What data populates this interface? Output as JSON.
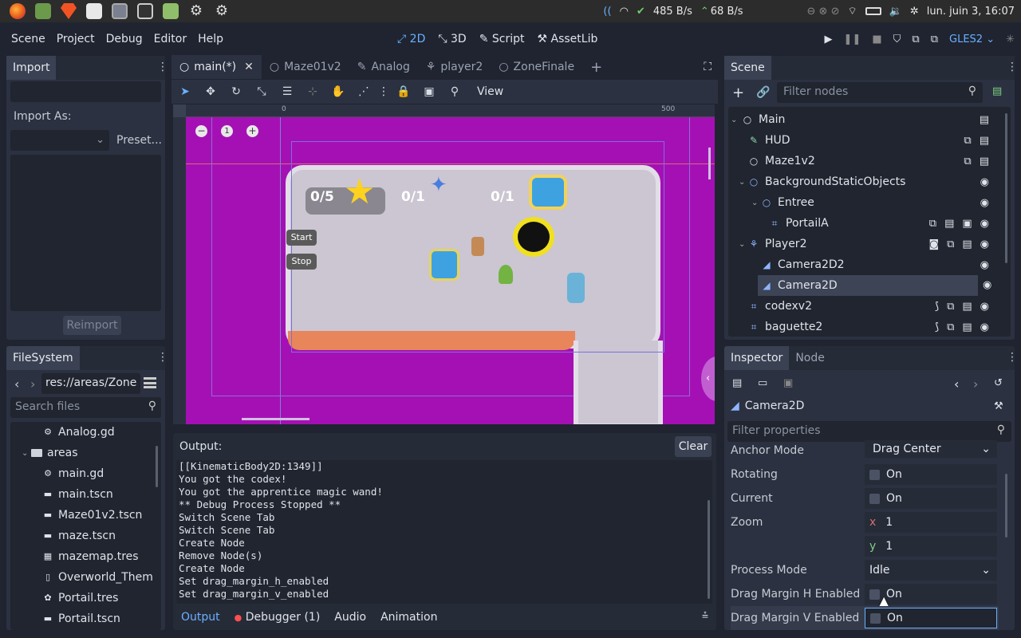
{
  "os": {
    "net_down": "485 B/s",
    "net_up": "68 B/s",
    "clock": "lun. juin  3, 16:07"
  },
  "menu": [
    "Scene",
    "Project",
    "Debug",
    "Editor",
    "Help"
  ],
  "modes": {
    "m2d": "2D",
    "m3d": "3D",
    "script": "Script",
    "assetlib": "AssetLib"
  },
  "renderer": "GLES2",
  "import": {
    "tab": "Import",
    "import_as_label": "Import As:",
    "preset_label": "Preset...",
    "reimport_label": "Reimport"
  },
  "filesystem": {
    "tab": "FileSystem",
    "path": "res://areas/Zone",
    "search_placeholder": "Search files",
    "items": [
      {
        "name": "Analog.gd",
        "icon": "gear-icon"
      },
      {
        "name": "areas",
        "icon": "folder-icon"
      },
      {
        "name": "main.gd",
        "icon": "gear-icon"
      },
      {
        "name": "main.tscn",
        "icon": "clapper-icon"
      },
      {
        "name": "Maze01v2.tscn",
        "icon": "clapper-icon"
      },
      {
        "name": "maze.tscn",
        "icon": "clapper-icon"
      },
      {
        "name": "mazemap.tres",
        "icon": "grid-icon"
      },
      {
        "name": "Overworld_Them",
        "icon": "file-icon"
      },
      {
        "name": "Portail.tres",
        "icon": "palette-icon"
      },
      {
        "name": "Portail.tscn",
        "icon": "clapper-icon"
      }
    ]
  },
  "editor_tabs": [
    "main(*)",
    "Maze01v2",
    "Analog",
    "player2",
    "ZoneFinale"
  ],
  "toolbar": {
    "view_label": "View"
  },
  "ruler": {
    "mark_0": "0",
    "mark_500": "500"
  },
  "zoom_reset": "1",
  "game": {
    "stars": "0/5",
    "wand_count": "0/1",
    "book_count": "0/1",
    "start_label": "Start",
    "stop_label": "Stop"
  },
  "output": {
    "title": "Output:",
    "clear_label": "Clear",
    "lines": [
      "[[KinematicBody2D:1349]]",
      "You got the codex!",
      "You got the apprentice magic wand!",
      "** Debug Process Stopped **",
      "Switch Scene Tab",
      "Switch Scene Tab",
      "Create Node",
      "Remove Node(s)",
      "Create Node",
      "Set drag_margin_h_enabled",
      "Set drag_margin_v_enabled"
    ],
    "bottom_tabs": [
      "Output",
      "Debugger (1)",
      "Audio",
      "Animation"
    ]
  },
  "scene": {
    "tab": "Scene",
    "filter_placeholder": "Filter nodes",
    "nodes": [
      {
        "name": "Main",
        "indent": 0
      },
      {
        "name": "HUD",
        "indent": 1
      },
      {
        "name": "Maze1v2",
        "indent": 1
      },
      {
        "name": "BackgroundStaticObjects",
        "indent": 1
      },
      {
        "name": "Entree",
        "indent": 2
      },
      {
        "name": "PortailA",
        "indent": 3
      },
      {
        "name": "Player2",
        "indent": 1
      },
      {
        "name": "Camera2D2",
        "indent": 2
      },
      {
        "name": "Camera2D",
        "indent": 2
      },
      {
        "name": "codexv2",
        "indent": 1
      },
      {
        "name": "baguette2",
        "indent": 1
      }
    ]
  },
  "inspector": {
    "tab_inspector": "Inspector",
    "tab_node": "Node",
    "object_name": "Camera2D",
    "filter_placeholder": "Filter properties",
    "props": {
      "anchor_mode": {
        "label": "Anchor Mode",
        "value": "Drag Center"
      },
      "rotating": {
        "label": "Rotating",
        "value": "On"
      },
      "current": {
        "label": "Current",
        "value": "On"
      },
      "zoom": {
        "label": "Zoom",
        "x_axis": "x",
        "y_axis": "y",
        "x": "1",
        "y": "1"
      },
      "process_mode": {
        "label": "Process Mode",
        "value": "Idle"
      },
      "drag_margin_h": {
        "label": "Drag Margin H Enabled",
        "value": "On"
      },
      "drag_margin_v": {
        "label": "Drag Margin V Enabled",
        "value": "On"
      }
    }
  }
}
